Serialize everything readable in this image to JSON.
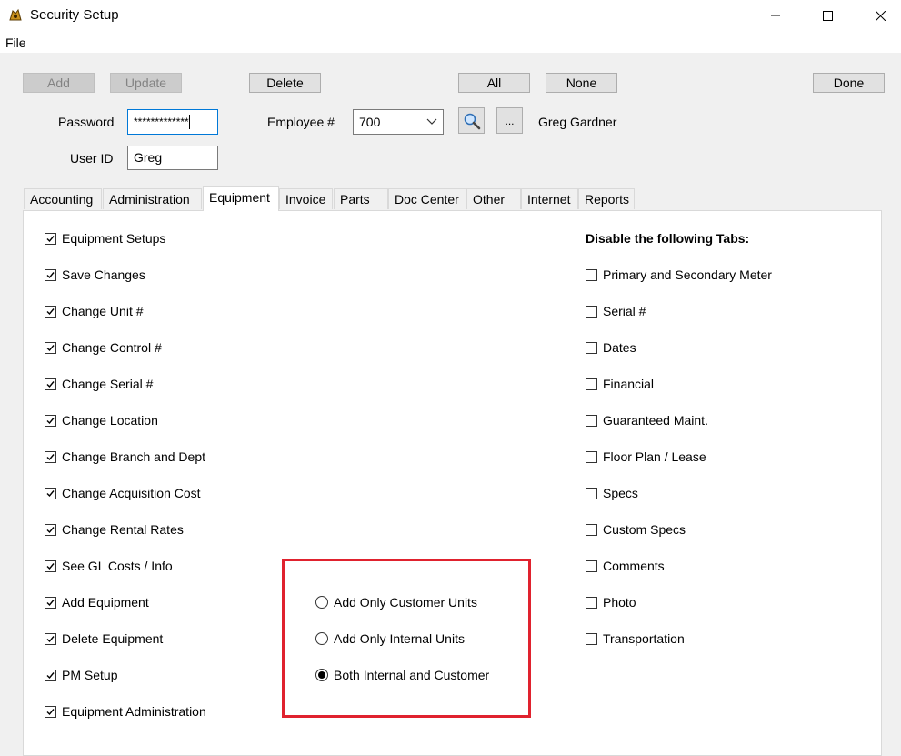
{
  "window": {
    "title": "Security Setup",
    "menu": [
      "File"
    ]
  },
  "toolbar": {
    "add": "Add",
    "update": "Update",
    "delete": "Delete",
    "all": "All",
    "none": "None",
    "done": "Done",
    "browse": "..."
  },
  "form": {
    "password_label": "Password",
    "password_value": "*************",
    "employee_label": "Employee #",
    "employee_value": "700",
    "employee_name": "Greg Gardner",
    "userid_label": "User ID",
    "userid_value": "Greg"
  },
  "tabs": [
    "Accounting",
    "Administration",
    "Equipment",
    "Invoice",
    "Parts",
    "Doc Center",
    "Other",
    "Internet",
    "Reports"
  ],
  "active_tab": "Equipment",
  "permissions": [
    {
      "label": "Equipment Setups",
      "checked": true
    },
    {
      "label": "Save Changes",
      "checked": true
    },
    {
      "label": "Change Unit #",
      "checked": true
    },
    {
      "label": "Change Control #",
      "checked": true
    },
    {
      "label": "Change Serial #",
      "checked": true
    },
    {
      "label": "Change Location",
      "checked": true
    },
    {
      "label": "Change Branch and Dept",
      "checked": true
    },
    {
      "label": "Change Acquisition Cost",
      "checked": true
    },
    {
      "label": "Change Rental Rates",
      "checked": true
    },
    {
      "label": "See GL Costs / Info",
      "checked": true
    },
    {
      "label": "Add Equipment",
      "checked": true
    },
    {
      "label": "Delete Equipment",
      "checked": true
    },
    {
      "label": "PM Setup",
      "checked": true
    },
    {
      "label": "Equipment Administration",
      "checked": true
    }
  ],
  "unit_options": [
    {
      "label": "Add Only Customer Units",
      "selected": false
    },
    {
      "label": "Add Only Internal Units",
      "selected": false
    },
    {
      "label": "Both Internal and Customer",
      "selected": true
    }
  ],
  "disable_tabs": {
    "heading": "Disable the following Tabs:",
    "items": [
      {
        "label": "Primary and Secondary Meter",
        "checked": false
      },
      {
        "label": "Serial #",
        "checked": false
      },
      {
        "label": "Dates",
        "checked": false
      },
      {
        "label": "Financial",
        "checked": false
      },
      {
        "label": "Guaranteed Maint.",
        "checked": false
      },
      {
        "label": "Floor Plan / Lease",
        "checked": false
      },
      {
        "label": "Specs",
        "checked": false
      },
      {
        "label": "Custom Specs",
        "checked": false
      },
      {
        "label": "Comments",
        "checked": false
      },
      {
        "label": "Photo",
        "checked": false
      },
      {
        "label": "Transportation",
        "checked": false
      }
    ]
  },
  "colors": {
    "highlight_box": "#e0222e",
    "focus_border": "#0078d7"
  }
}
